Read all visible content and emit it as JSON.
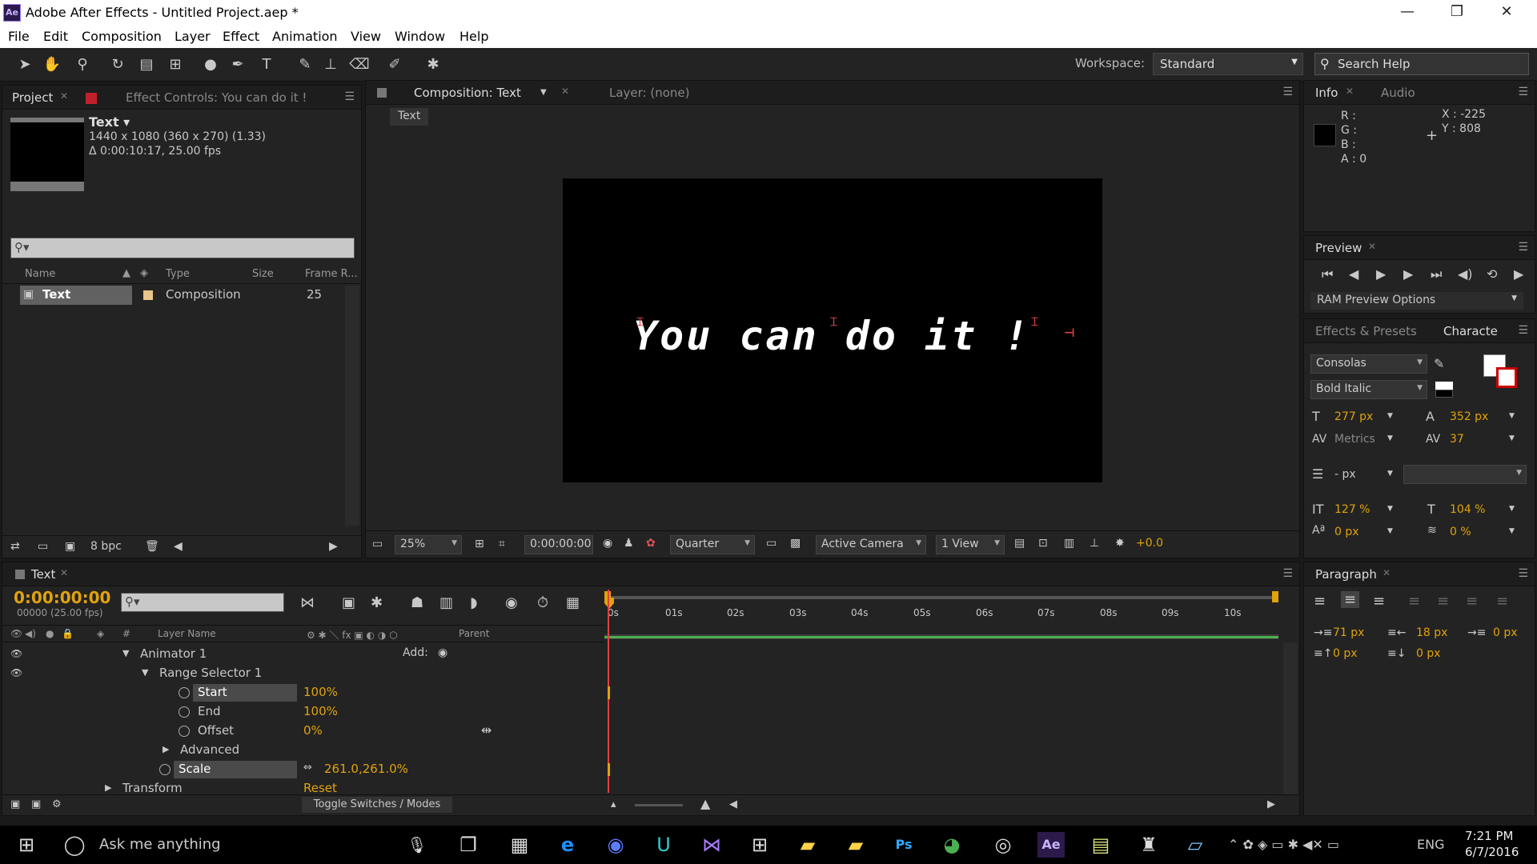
{
  "window": {
    "title": "Adobe After Effects - Untitled Project.aep *",
    "logo": "Ae",
    "minimize": "—",
    "maximize": "❐",
    "close": "✕"
  },
  "menu": [
    "File",
    "Edit",
    "Composition",
    "Layer",
    "Effect",
    "Animation",
    "View",
    "Window",
    "Help"
  ],
  "toolbar": {
    "workspace_label": "Workspace:",
    "workspace_value": "Standard",
    "search_placeholder": "Search Help"
  },
  "project": {
    "tab_project": "Project",
    "tab_effect_controls": "Effect Controls: You can do it !",
    "comp_name": "Text ▾",
    "comp_size": "1440 x 1080  (360 x 270) (1.33)",
    "comp_duration": "Δ 0:00:10:17, 25.00 fps",
    "columns": {
      "name": "Name",
      "type": "Type",
      "size": "Size",
      "frame_rate": "Frame R..."
    },
    "items": [
      {
        "name": "Text",
        "type": "Composition",
        "frame_rate": "25"
      }
    ],
    "bpc": "8 bpc"
  },
  "composition": {
    "tab": "Composition: Text",
    "layer_tab": "Layer: (none)",
    "breadcrumb": "Text",
    "canvas_text": "You can do it !",
    "zoom": "25%",
    "timecode": "0:00:00:00",
    "resolution": "Quarter",
    "camera": "Active Camera",
    "views": "1 View",
    "exposure": "+0.0"
  },
  "info": {
    "tab_info": "Info",
    "tab_audio": "Audio",
    "r": "R :",
    "g": "G :",
    "b": "B :",
    "a": "A :  0",
    "x": "X : -225",
    "y": "Y : 808"
  },
  "preview": {
    "tab": "Preview",
    "ram_options": "RAM Preview Options"
  },
  "character": {
    "tab_effects": "Effects & Presets",
    "tab_character": "Characte",
    "font": "Consolas",
    "style": "Bold Italic",
    "size": "277 px",
    "leading": "352 px",
    "kerning": "Metrics",
    "tracking": "37",
    "stroke": "- px",
    "vscale": "127 %",
    "hscale": "104 %",
    "baseline": "0 px",
    "tsume": "0 %"
  },
  "paragraph": {
    "tab": "Paragraph",
    "indent_left": "71 px",
    "indent_right": "18 px",
    "indent_first": "0 px",
    "space_before": "0 px",
    "space_after": "0 px"
  },
  "timeline": {
    "tab": "Text",
    "timecode": "0:00:00:00",
    "frames": "00000 (25.00 fps)",
    "columns": {
      "hash": "#",
      "layer_name": "Layer Name",
      "parent": "Parent"
    },
    "rulers": [
      "0s",
      "01s",
      "02s",
      "03s",
      "04s",
      "05s",
      "06s",
      "07s",
      "08s",
      "09s",
      "10s"
    ],
    "add_label": "Add:",
    "rows": [
      {
        "label": "Animator 1",
        "value": ""
      },
      {
        "label": "Range Selector 1",
        "value": ""
      },
      {
        "label": "Start",
        "value": "100%"
      },
      {
        "label": "End",
        "value": "100%"
      },
      {
        "label": "Offset",
        "value": "0%"
      },
      {
        "label": "Advanced",
        "value": ""
      },
      {
        "label": "Scale",
        "value": "261.0,261.0%"
      },
      {
        "label": "Transform",
        "value": "Reset"
      }
    ],
    "toggle": "Toggle Switches / Modes"
  },
  "taskbar": {
    "search": "Ask me anything",
    "lang": "ENG",
    "time": "7:21 PM",
    "date": "6/7/2016"
  },
  "colors": {
    "accent": "#e0a30c",
    "link": "#58a6ff",
    "ae_purple": "#9a7cff"
  }
}
